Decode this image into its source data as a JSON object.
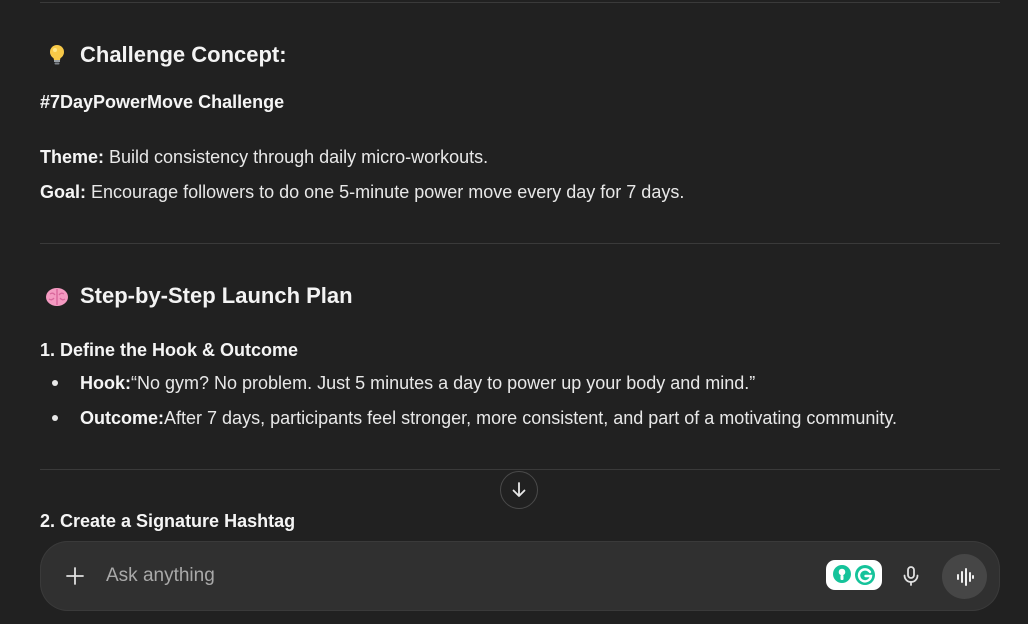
{
  "section1": {
    "heading": "Challenge Concept:",
    "heading_icon": "light-bulb-icon",
    "challenge_name": "#7DayPowerMove Challenge",
    "theme_label": "Theme:",
    "theme_text": " Build consistency through daily micro-workouts.",
    "goal_label": "Goal:",
    "goal_text": " Encourage followers to do one 5-minute power move every day for 7 days."
  },
  "section2": {
    "heading": "Step-by-Step Launch Plan",
    "heading_icon": "brain-icon",
    "step1_title": "1. Define the Hook & Outcome",
    "bullets": [
      {
        "label": "Hook:",
        "text": " “No gym? No problem. Just 5 minutes a day to power up your body and mind.”"
      },
      {
        "label": "Outcome:",
        "text": " After 7 days, participants feel stronger, more consistent, and part of a motivating community."
      }
    ],
    "step2_title": "2. Create a Signature Hashtag"
  },
  "composer": {
    "placeholder": "Ask anything",
    "value": ""
  },
  "colors": {
    "background": "#212121",
    "composer": "#303030",
    "grammarly_green": "#15c39a"
  }
}
